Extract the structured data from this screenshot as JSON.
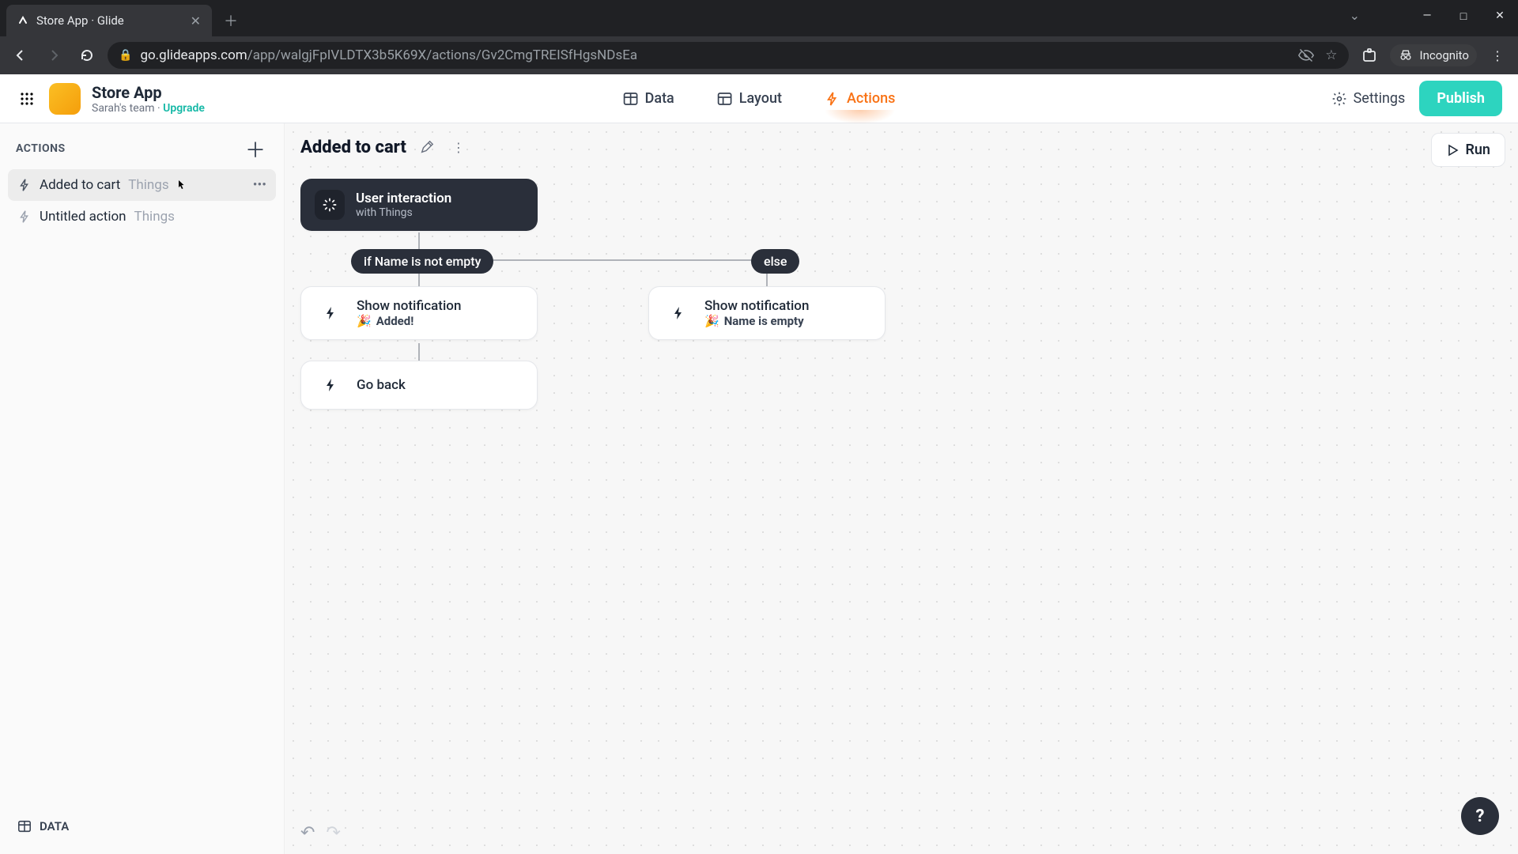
{
  "browser": {
    "tab_title": "Store App · Glide",
    "url_domain": "go.glideapps.com",
    "url_path": "/app/walgjFpIVLDTX3b5K69X/actions/Gv2CmgTREISfHgsNDsEa",
    "incognito_label": "Incognito"
  },
  "header": {
    "app_name": "Store App",
    "team_name": "Sarah's team",
    "separator": " · ",
    "upgrade_label": "Upgrade",
    "tabs": {
      "data": "Data",
      "layout": "Layout",
      "actions": "Actions"
    },
    "settings_label": "Settings",
    "publish_label": "Publish"
  },
  "sidebar": {
    "title": "ACTIONS",
    "items": [
      {
        "name": "Added to cart",
        "table": "Things",
        "selected": true
      },
      {
        "name": "Untitled action",
        "table": "Things",
        "selected": false
      }
    ],
    "footer_label": "DATA"
  },
  "canvas": {
    "title": "Added to cart",
    "run_label": "Run",
    "trigger": {
      "title": "User interaction",
      "subtitle": "with Things"
    },
    "conditions": {
      "if_label": "if Name is not empty",
      "else_label": "else"
    },
    "steps": {
      "left1": {
        "title": "Show notification",
        "detail": "Added!"
      },
      "left2": {
        "title": "Go back"
      },
      "right1": {
        "title": "Show notification",
        "detail": "Name is empty"
      }
    },
    "help_label": "?"
  }
}
